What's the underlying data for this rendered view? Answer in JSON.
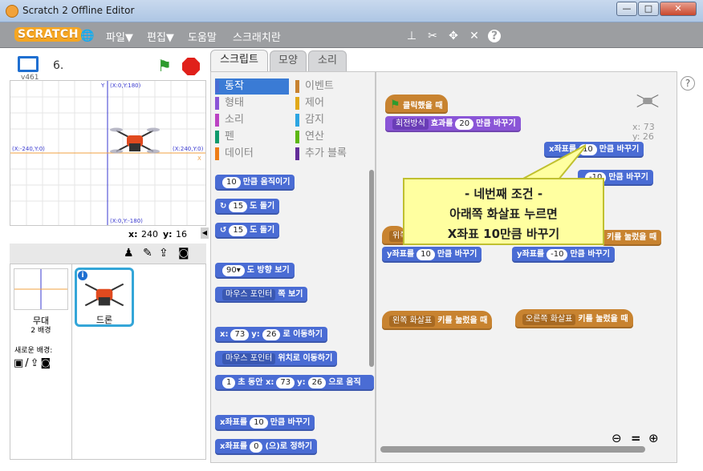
{
  "window": {
    "title": "Scratch 2 Offline Editor",
    "minimize": "—",
    "maximize": "□",
    "close": "✕"
  },
  "menubar": {
    "logo": "SCRATCH",
    "items": [
      "파일▼",
      "편집▼",
      "도움말",
      "스크래치란"
    ],
    "tool_icons": [
      "stamp-icon",
      "cut-icon",
      "grow-icon",
      "shrink-icon",
      "help-icon"
    ]
  },
  "stage": {
    "version": "v461",
    "project_name": "6.",
    "coord_labels": {
      "top": "(X:0,Y:180)",
      "bottom": "(X:0,Y:-180)",
      "left": "(X:-240,Y:0)",
      "right": "(X:240,Y:0)",
      "y_axis": "Y",
      "x_axis": "X"
    },
    "mouse_x_label": "x:",
    "mouse_x": "240",
    "mouse_y_label": "y:",
    "mouse_y": "16"
  },
  "sprites": {
    "stage_label": "무대",
    "stage_backdrops": "2 배경",
    "new_backdrop_label": "새로운 배경:",
    "selected_sprite": "드론"
  },
  "tabs": [
    "스크립트",
    "모양",
    "소리"
  ],
  "categories": {
    "left": [
      {
        "label": "동작",
        "color": "#4a6cd4",
        "active": true
      },
      {
        "label": "형태",
        "color": "#8a55d7"
      },
      {
        "label": "소리",
        "color": "#bb42c3"
      },
      {
        "label": "펜",
        "color": "#0e9a6c"
      },
      {
        "label": "데이터",
        "color": "#ee7d16"
      }
    ],
    "right": [
      {
        "label": "이벤트",
        "color": "#c88330"
      },
      {
        "label": "제어",
        "color": "#e1a91a"
      },
      {
        "label": "감지",
        "color": "#2ca5e2"
      },
      {
        "label": "연산",
        "color": "#5cb712"
      },
      {
        "label": "추가 블록",
        "color": "#632d99"
      }
    ]
  },
  "palette_blocks": {
    "move": {
      "v": "10",
      "t": "만큼 움직이기"
    },
    "turn_cw": {
      "v": "15",
      "t": "도 돌기"
    },
    "turn_ccw": {
      "v": "15",
      "t": "도 돌기"
    },
    "point_dir": {
      "v": "90▾",
      "t": "도 방향 보기"
    },
    "point_towards": {
      "v": "마우스 포인터",
      "t": "쪽 보기"
    },
    "goto_xy": {
      "a": "x:",
      "x": "73",
      "b": "y:",
      "y": "26",
      "t": "로 이동하기"
    },
    "goto": {
      "v": "마우스 포인터",
      "t": "위치로 이동하기"
    },
    "glide": {
      "n": "1",
      "a": "초 동안 x:",
      "x": "73",
      "b": "y:",
      "y": "26",
      "t": "으로 움직"
    },
    "change_x": {
      "a": "x좌표를",
      "v": "10",
      "t": "만큼 바꾸기"
    },
    "set_x": {
      "a": "x좌표를",
      "v": "0",
      "t": "(으)로 정하기"
    }
  },
  "scripts": {
    "flag_hat": "클릭했을 때",
    "rotation_dd": "회전방식",
    "rotation_a": "효과를",
    "rotation_v": "20",
    "rotation_t": "만큼 바꾸기",
    "changex_a": "x좌표를",
    "changex_v": "10",
    "changex_t": "만큼 바꾸기",
    "changex2_v": "-10",
    "changex2_t": "만큼 바꾸기",
    "key_pressed": "키를 눌렀을 때",
    "left_arrow": "왼쪽 화살표",
    "right_arrow": "오른쪽 화살표",
    "up_dd": "위쪽",
    "changey_a": "y좌표를",
    "changey_v": "10",
    "changey_t": "만큼 바꾸기",
    "changey2_v": "-10",
    "changey2_t": "만큼 바꾸기",
    "sprite_x": "x: 73",
    "sprite_y": "y: 26"
  },
  "callout": {
    "line1": "- 네번째 조건 -",
    "line2": "아래쪽 화살표 누르면",
    "line3": "X좌표 10만큼 바꾸기"
  },
  "zoom": {
    "out": "⊖",
    "reset": "=",
    "in": "⊕"
  }
}
